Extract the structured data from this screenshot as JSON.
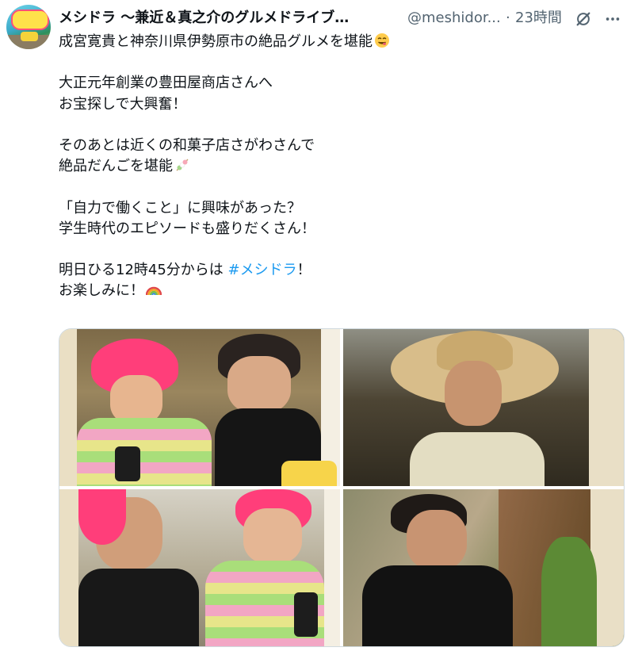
{
  "header": {
    "name": "メシドラ ～兼近＆真之介のグルメドライブ…",
    "handle": "@meshidor...",
    "separator": "·",
    "time": "23時間",
    "grok_icon": "grok-icon",
    "more_icon": "more-icon"
  },
  "tweet": {
    "lines": [
      "成宮寛貴と神奈川県伊勢原市の絶品グルメを堪能",
      "",
      "大正元年創業の豊田屋商店さんへ",
      "お宝探しで大興奮！",
      "",
      "そのあとは近くの和菓子店さがわさんで",
      "絶品だんごを堪能",
      "",
      "「自力で働くこと」に興味があった？",
      "学生時代のエピソードも盛りだくさん！",
      "",
      "明日ひる12時45分からは ",
      "お楽しみに！"
    ],
    "hashtag": "#メシドラ",
    "after_hashtag": "！",
    "emojis": [
      "yum-emoji",
      "dango-emoji",
      "rainbow-emoji"
    ]
  },
  "media": {
    "images": [
      "photo-shop-scene",
      "photo-straw-hat",
      "photo-two-men",
      "photo-seated-man"
    ]
  },
  "colors": {
    "text": "#0f1419",
    "secondary": "#536471",
    "link": "#1d9bf0",
    "border": "#cfd9de"
  }
}
